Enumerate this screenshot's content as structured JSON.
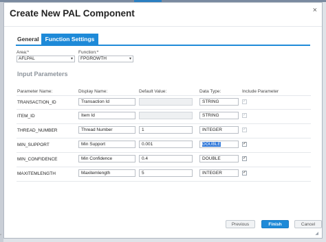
{
  "dialog": {
    "title": "Create New PAL Component",
    "close_glyph": "×"
  },
  "tabs": [
    {
      "label": "General",
      "active": false
    },
    {
      "label": "Function Settings",
      "active": true
    }
  ],
  "area": {
    "label": "Area:*",
    "value": "AFLPAL"
  },
  "function": {
    "label": "Function:*",
    "value": "FPGROWTH"
  },
  "section_title": "Input Parameters",
  "columns": {
    "param_name": "Parameter Name:",
    "display_name": "Display Name:",
    "default_value": "Default Value:",
    "data_type": "Data Type:",
    "include": "Include Parameter"
  },
  "rows": [
    {
      "name": "TRANSACTION_ID",
      "display": "Transaction Id",
      "default": "",
      "type": "STRING",
      "include": true,
      "include_enabled": false
    },
    {
      "name": "ITEM_ID",
      "display": "Item Id",
      "default": "",
      "type": "STRING",
      "include": true,
      "include_enabled": false
    },
    {
      "name": "THREAD_NUMBER",
      "display": "Thread Number",
      "default": "1",
      "type": "INTEGER",
      "include": true,
      "include_enabled": false
    },
    {
      "name": "MIN_SUPPORT",
      "display": "Min Support",
      "default": "0.001",
      "type": "DOUBLE",
      "include": true,
      "include_enabled": true
    },
    {
      "name": "MIN_CONFIDENCE",
      "display": "Min Confidence",
      "default": "0.4",
      "type": "DOUBLE",
      "include": true,
      "include_enabled": true
    },
    {
      "name": "MAXITEMLENGTH",
      "display": "Maxitemlength",
      "default": "5",
      "type": "INTEGER",
      "include": true,
      "include_enabled": true
    }
  ],
  "buttons": {
    "previous": "Previous",
    "finish": "Finish",
    "cancel": "Cancel"
  },
  "check_glyph": "✓",
  "chevron_glyph": "▾",
  "colors": {
    "accent": "#1e8ad8",
    "selection": "#2a74d8"
  }
}
